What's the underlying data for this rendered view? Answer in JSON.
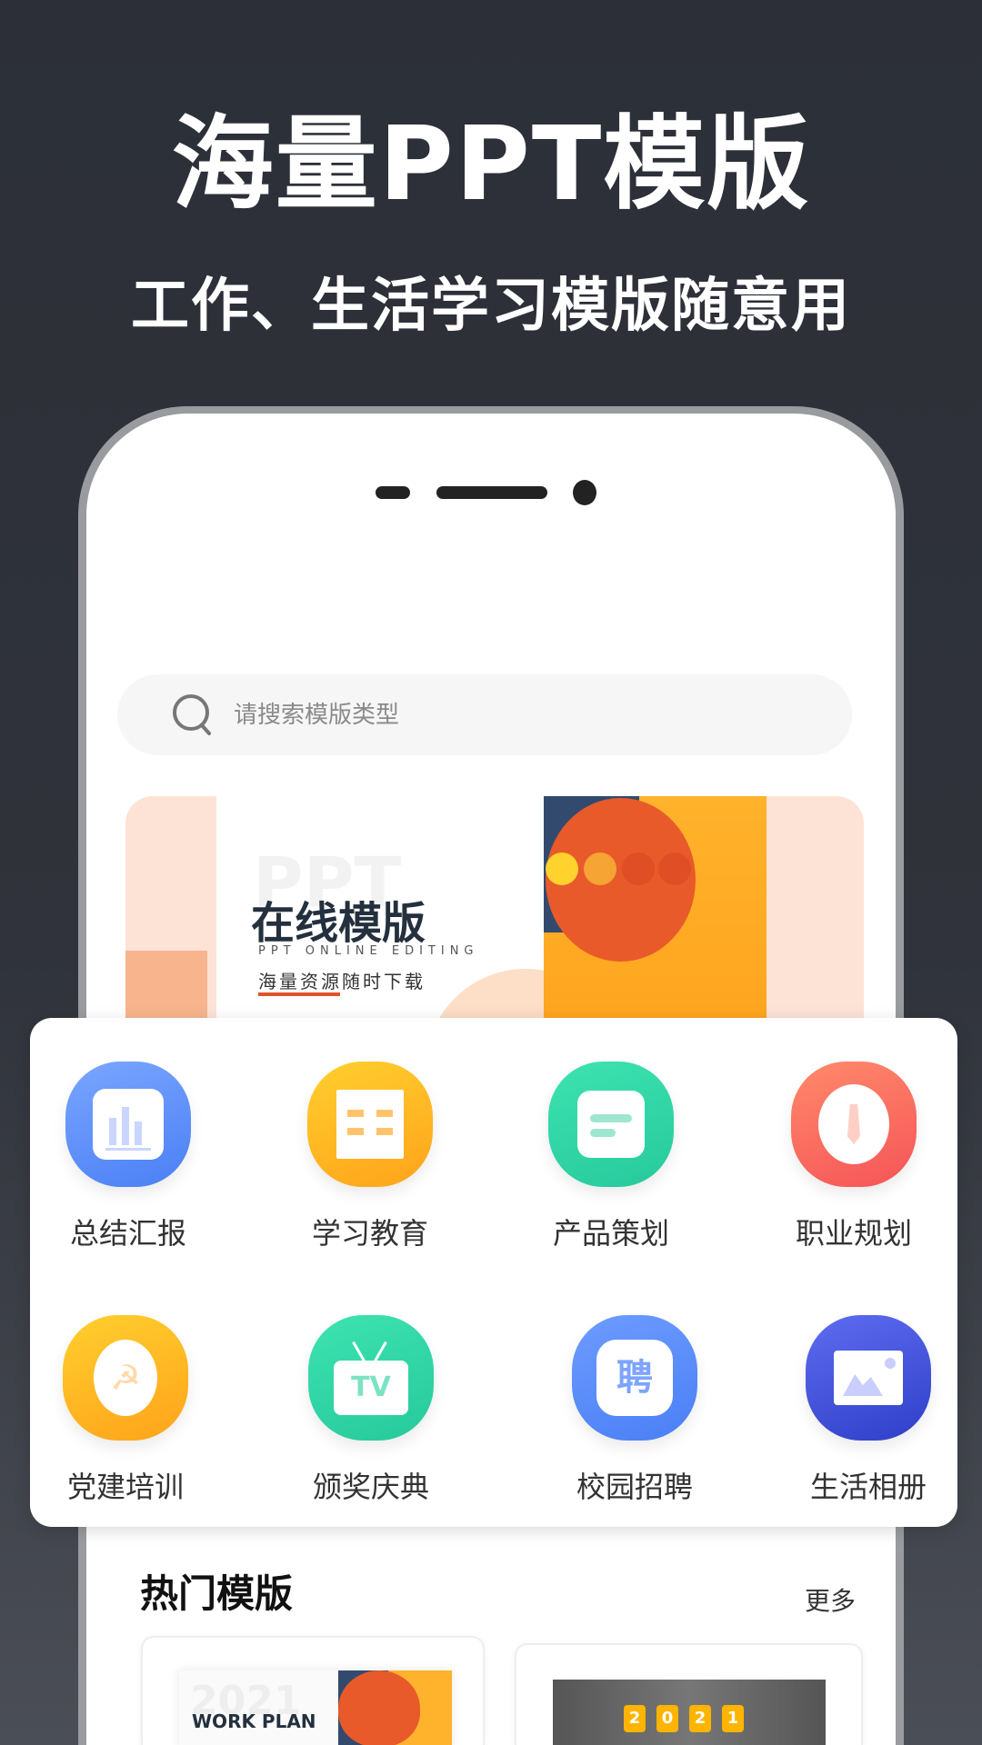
{
  "hero": {
    "title": "海量PPT模版",
    "subtitle": "工作、生活学习模版随意用"
  },
  "search": {
    "placeholder": "请搜索模版类型",
    "icon": "search-icon"
  },
  "banner": {
    "watermark": "PPT",
    "title": "在线模版",
    "subtitle": "PPT ONLINE EDITING",
    "tagline": "海量资源随时下载"
  },
  "categories": [
    {
      "label": "总结汇报",
      "icon": "bar-chart-icon",
      "color": "#4f86f7"
    },
    {
      "label": "学习教育",
      "icon": "book-icon",
      "color": "#ffac1c"
    },
    {
      "label": "产品策划",
      "icon": "document-icon",
      "color": "#2ecfa3"
    },
    {
      "label": "职业规划",
      "icon": "tie-icon",
      "color": "#f9605a"
    },
    {
      "label": "党建培训",
      "icon": "hammer-sickle-icon",
      "color": "#ffac1c"
    },
    {
      "label": "颁奖庆典",
      "icon": "tv-icon",
      "color": "#2ecfa3"
    },
    {
      "label": "校园招聘",
      "icon": "recruit-icon",
      "color": "#4f86f7",
      "glyph": "聘"
    },
    {
      "label": "生活相册",
      "icon": "photo-album-icon",
      "color": "#3d4bd6"
    }
  ],
  "hot": {
    "title": "热门模版",
    "more": "更多",
    "cards": [
      {
        "year": "2021",
        "text": "WORK PLAN"
      },
      {
        "digits": [
          "2",
          "0",
          "2",
          "1"
        ]
      }
    ]
  }
}
